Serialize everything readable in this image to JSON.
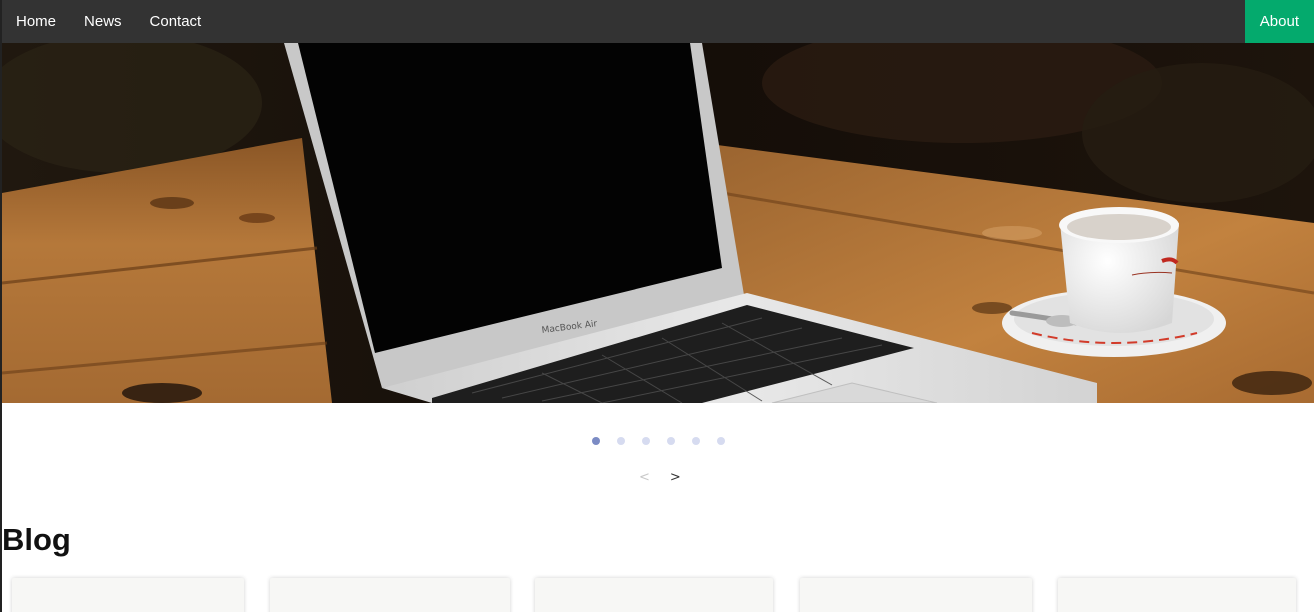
{
  "nav": {
    "items": [
      {
        "label": "Home"
      },
      {
        "label": "News"
      },
      {
        "label": "Contact"
      }
    ],
    "active_item": {
      "label": "About"
    }
  },
  "slider": {
    "image_alt": "Laptop and coffee cup on a wooden table",
    "dot_count": 6,
    "active_dot": 0,
    "prev_label": "<",
    "next_label": ">"
  },
  "blog": {
    "heading": "Blog",
    "card_count": 5
  },
  "colors": {
    "nav_bg": "#333333",
    "active_tab": "#04AA6D",
    "dot_active": "#7b8bc4",
    "dot_inactive": "#d6dbf0"
  }
}
